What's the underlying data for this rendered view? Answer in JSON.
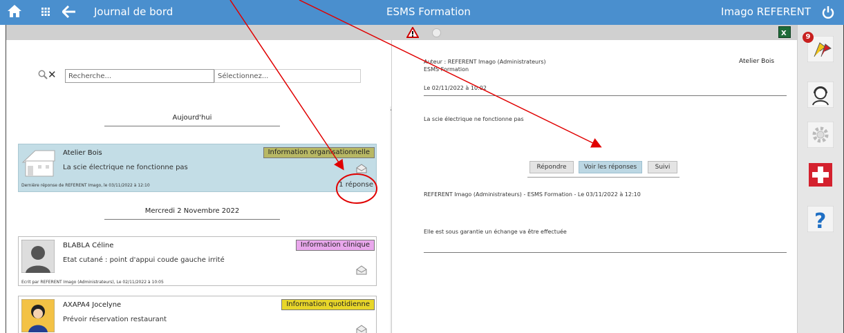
{
  "header": {
    "title": "Journal de bord",
    "center": "ESMS Formation",
    "user": "Imago REFERENT"
  },
  "search": {
    "placeholder": "Recherche...",
    "select_placeholder": "Sélectionnez..."
  },
  "days": {
    "today": "Aujourd'hui",
    "wednesday": "Mercredi 2 Novembre 2022"
  },
  "entries": [
    {
      "name": "Atelier Bois",
      "message": "La scie électrique ne fonctionne pas",
      "tag": "Information organisationnelle",
      "tag_color": "#b8b864",
      "footer": "Dernière réponse de REFERENT Imago, le 03/11/2022 à 12:10",
      "answers": "1 réponse"
    },
    {
      "name": "BLABLA Céline",
      "message": "Etat cutané :  point d'appui coude gauche irrité",
      "tag": "Information clinique",
      "tag_color": "#e9a7ec",
      "footer": "Ecrit par REFERENT Imago (Administrateurs), Le 02/11/2022 à 10:05"
    },
    {
      "name": "AXAPA4 Jocelyne",
      "message": "Prévoir réservation restaurant",
      "tag": "Information quotidienne",
      "tag_color": "#e8d62a"
    }
  ],
  "detail": {
    "author": "Auteur : REFERENT Imago (Administrateurs)",
    "organization": "ESMS Formation",
    "place": "Atelier Bois",
    "date": "Le 02/11/2022 à 10:02",
    "message": "La scie électrique ne fonctionne pas",
    "buttons": {
      "reply": "Répondre",
      "view_replies": "Voir les réponses",
      "follow": "Suivi"
    },
    "reply_header": "REFERENT Imago (Administrateurs) - ESMS Formation - Le 03/11/2022 à 12:10",
    "reply_text": "Elle est sous garantie un échange va être effectuée"
  },
  "sidebar": {
    "notifications_count": "9"
  },
  "colors": {
    "topbar": "#4a8fce",
    "active_card": "#c3dde6",
    "annotation": "#e00000",
    "help": "#1f6fc4",
    "medical": "#d4212e"
  }
}
